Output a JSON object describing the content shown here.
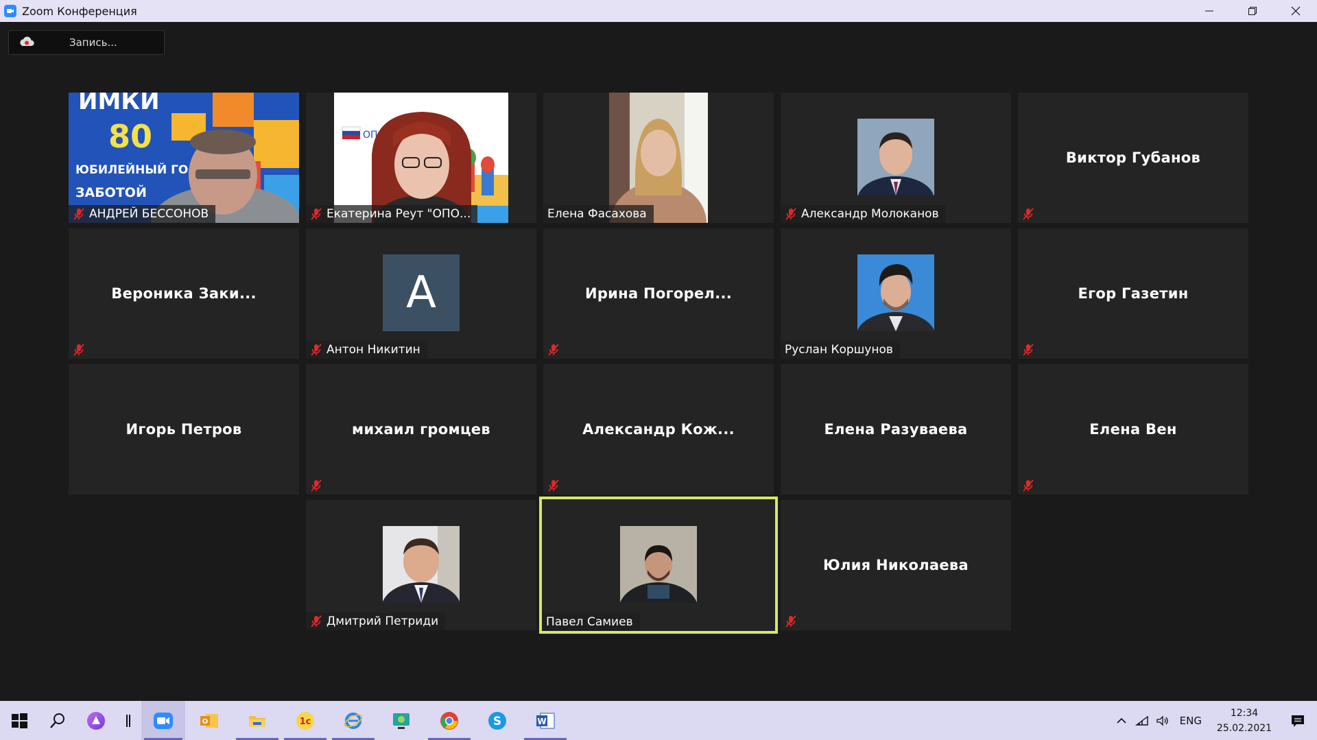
{
  "window": {
    "title": "Zoom Конференция"
  },
  "toolbar": {
    "record_label": "Запись..."
  },
  "participants": [
    {
      "name": "АНДРЕЙ БЕССОНОВ",
      "muted": true,
      "display": "video"
    },
    {
      "name": "Екатерина Реут \"ОПО...",
      "muted": true,
      "display": "video"
    },
    {
      "name": "Елена Фасахова",
      "muted": false,
      "display": "video"
    },
    {
      "name": "Александр Молоканов",
      "muted": true,
      "display": "photo"
    },
    {
      "name": "Виктор Губанов",
      "muted": true,
      "display": "name"
    },
    {
      "name": "Вероника  Заки...",
      "muted": true,
      "display": "name"
    },
    {
      "name": "Антон Никитин",
      "muted": true,
      "display": "letter",
      "letter": "A"
    },
    {
      "name": "Ирина  Погорел...",
      "muted": true,
      "display": "name"
    },
    {
      "name": "Руслан Коршунов",
      "muted": false,
      "display": "photo"
    },
    {
      "name": "Егор Газетин",
      "muted": true,
      "display": "name"
    },
    {
      "name": "Игорь Петров",
      "muted": false,
      "display": "name"
    },
    {
      "name": "михаил громцев",
      "muted": true,
      "display": "name"
    },
    {
      "name": "Александр  Кож...",
      "muted": true,
      "display": "name"
    },
    {
      "name": "Елена Разуваева",
      "muted": false,
      "display": "name"
    },
    {
      "name": "Елена Вен",
      "muted": true,
      "display": "name"
    },
    {
      "name": "Дмитрий Петриди",
      "muted": true,
      "display": "photo"
    },
    {
      "name": "Павел Самиев",
      "muted": false,
      "display": "photo",
      "active_speaker": true
    },
    {
      "name": "Юлия Николаева",
      "muted": true,
      "display": "name"
    }
  ],
  "video_overlays": {
    "bessonov_banner_top": "ИМКИ",
    "bessonov_banner_num": "80",
    "bessonov_banner_line1": "ЮБИЛЕЙНЫЙ ГО",
    "bessonov_banner_line2": "ЗАБОТОЙ",
    "reut_logo_text": "ОПОР"
  },
  "taskbar": {
    "lang": "ENG",
    "time": "12:34",
    "date": "25.02.2021"
  },
  "colors": {
    "active_speaker_border": "#d7eb5b",
    "tile_bg": "#242424",
    "meeting_bg": "#1a1a1a",
    "mute_icon": "#e02828"
  }
}
